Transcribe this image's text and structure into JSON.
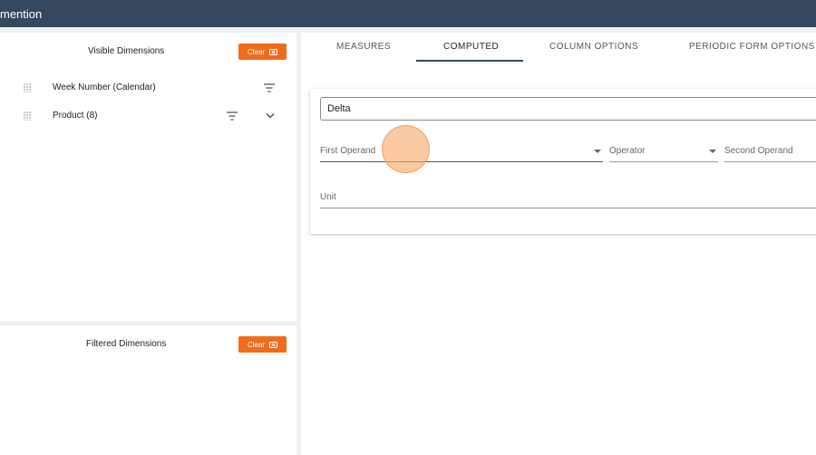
{
  "app": {
    "title": "mention"
  },
  "visible_dimensions": {
    "title": "Visible Dimensions",
    "clear_label": "Clear",
    "items": [
      {
        "label": "Week Number (Calendar)",
        "has_expand": false
      },
      {
        "label": "Product (8)",
        "has_expand": true
      }
    ]
  },
  "filtered_dimensions": {
    "title": "Filtered Dimensions",
    "clear_label": "Clear"
  },
  "tabs": [
    {
      "label": "MEASURES",
      "active": false
    },
    {
      "label": "COMPUTED",
      "active": true
    },
    {
      "label": "COLUMN OPTIONS",
      "active": false
    },
    {
      "label": "PERIODIC FORM OPTIONS",
      "active": false
    }
  ],
  "computed": {
    "name_value": "Delta",
    "first_operand_label": "First Operand",
    "operator_label": "Operator",
    "second_operand_label": "Second Operand",
    "unit_label": "Unit"
  },
  "colors": {
    "header": "#34495e",
    "accent": "#f06b1b",
    "click_indicator": "#f8aa6e"
  },
  "icons": [
    "drag-handle-icon",
    "filter-icon",
    "chevron-down-icon",
    "clear-x-icon",
    "dropdown-caret-icon"
  ]
}
